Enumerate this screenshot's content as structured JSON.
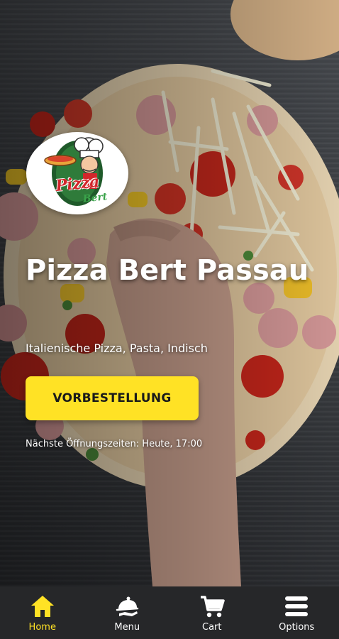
{
  "brand": {
    "logo_name": "Pizza",
    "logo_sub": "Bert"
  },
  "hero": {
    "title": "Pizza Bert Passau",
    "subtitle": "Italienische Pizza, Pasta, Indisch",
    "cta_label": "VORBESTELLUNG",
    "hours_text": "Nächste Öffnungszeiten: Heute, 17:00"
  },
  "nav": {
    "items": [
      {
        "label": "Home",
        "icon": "home-icon",
        "active": true
      },
      {
        "label": "Menu",
        "icon": "cloche-icon",
        "active": false
      },
      {
        "label": "Cart",
        "icon": "cart-icon",
        "active": false
      },
      {
        "label": "Options",
        "icon": "hamburger-icon",
        "active": false
      }
    ]
  },
  "colors": {
    "accent": "#ffe225",
    "nav_bg": "#262729",
    "logo_red": "#d3262b",
    "logo_green": "#3aa34a"
  }
}
